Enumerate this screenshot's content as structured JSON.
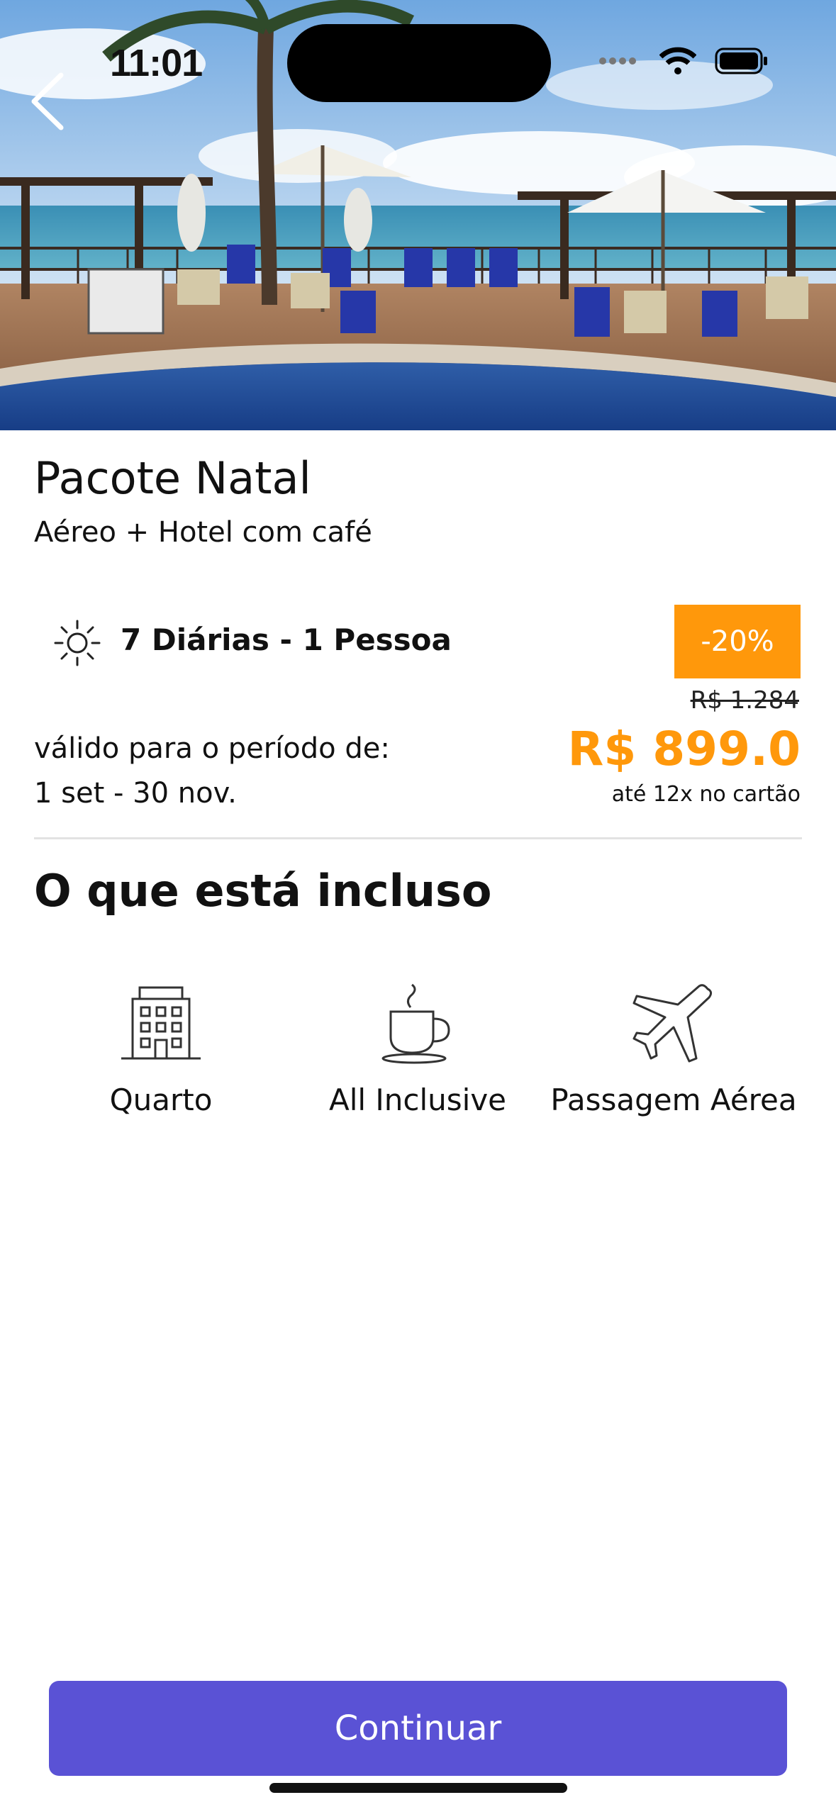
{
  "status_bar": {
    "time": "11:01"
  },
  "package": {
    "title": "Pacote Natal",
    "subtitle": "Aéreo + Hotel com café",
    "nights_people": "7 Diárias - 1 Pessoa",
    "discount_badge": "-20%",
    "old_price": "R$ 1.284",
    "price": "R$ 899.0",
    "installments": "até 12x no cartão",
    "validity_label": "válido para o período de:",
    "validity_range": "1 set - 30 nov."
  },
  "included": {
    "title": "O que está incluso",
    "items": [
      {
        "label": "Quarto",
        "icon": "hotel-building-icon"
      },
      {
        "label": "All Inclusive",
        "icon": "coffee-cup-icon"
      },
      {
        "label": "Passagem Aérea",
        "icon": "airplane-icon"
      }
    ]
  },
  "actions": {
    "continue_label": "Continuar"
  },
  "colors": {
    "accent": "#ff980b",
    "primary_button": "#5a52d5"
  }
}
